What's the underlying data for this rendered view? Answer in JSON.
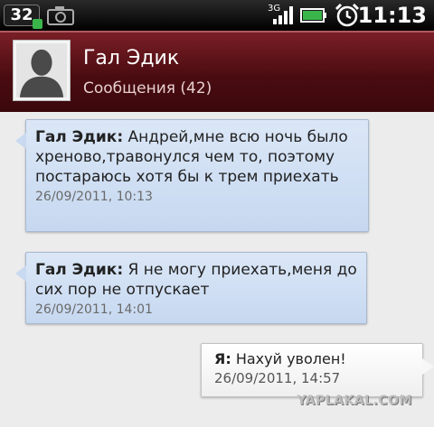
{
  "status_bar": {
    "notification_count": "32",
    "network_label": "3G",
    "time": "11:13",
    "icons": [
      "camera-icon",
      "signal-icon",
      "battery-icon",
      "alarm-icon"
    ]
  },
  "header": {
    "contact_name": "Гал Эдик",
    "subtitle": "Сообщения (42)"
  },
  "messages": [
    {
      "sender": "Гал Эдик:",
      "text": "Андрей,мне всю ночь было хреново,травонулся чем то, поэтому постараюсь хотя бы к трем приехать",
      "timestamp": "26/09/2011, 10:13",
      "direction": "incoming"
    },
    {
      "sender": "Гал Эдик:",
      "text": "Я не могу приехать,меня до сих пор не отпускает",
      "timestamp": "26/09/2011, 14:01",
      "direction": "incoming"
    },
    {
      "sender": "Я:",
      "text": "Нахуй уволен!",
      "timestamp": "26/09/2011, 14:57",
      "direction": "outgoing"
    }
  ],
  "watermark": "YAPLAKAL.COM",
  "colors": {
    "header_bg": "#4a0c11",
    "incoming_bubble": "#c6d8f0",
    "outgoing_bubble": "#efefef",
    "thread_bg": "#ececec"
  }
}
